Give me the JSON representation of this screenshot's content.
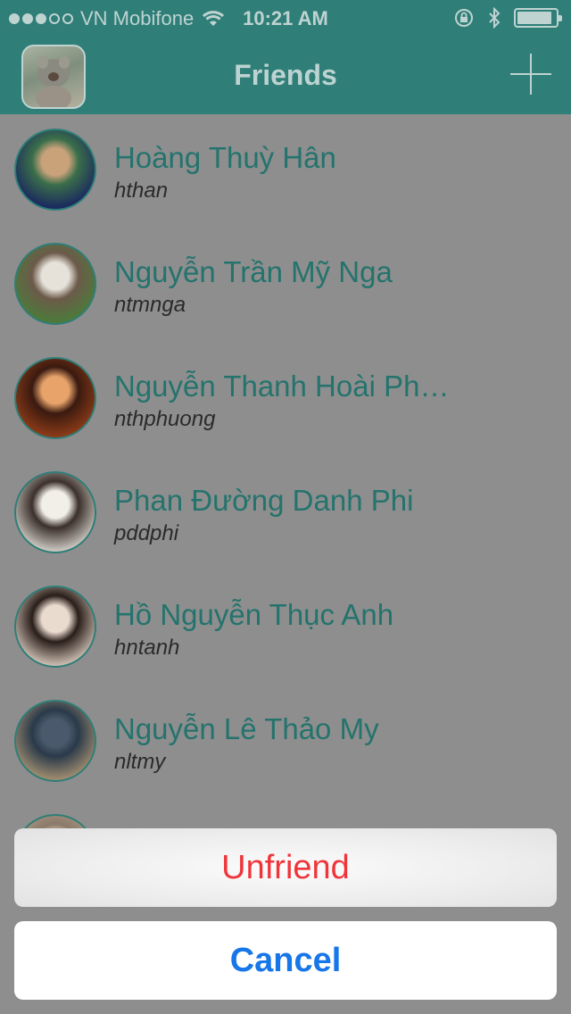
{
  "status_bar": {
    "carrier": "VN Mobifone",
    "time": "10:21 AM"
  },
  "nav": {
    "title": "Friends"
  },
  "friends": [
    {
      "name": "Hoàng Thuỳ Hân",
      "username": "hthan",
      "avatar_colors": [
        "#1b2a5e",
        "#c9a27a",
        "#3a6e4a"
      ]
    },
    {
      "name": "Nguyễn Trần Mỹ Nga",
      "username": "ntmnga",
      "avatar_colors": [
        "#4d7a3a",
        "#e6e2da",
        "#6c5a4a"
      ]
    },
    {
      "name": "Nguyễn Thanh Hoài Ph…",
      "username": "nthphuong",
      "avatar_colors": [
        "#8a3a18",
        "#e7a36a",
        "#3a1a10"
      ]
    },
    {
      "name": "Phan Đường Danh Phi",
      "username": "pddphi",
      "avatar_colors": [
        "#c8c4bd",
        "#f2efe9",
        "#3b2f2a"
      ]
    },
    {
      "name": "Hồ Nguyễn Thục Anh",
      "username": "hntanh",
      "avatar_colors": [
        "#c7b9ad",
        "#eadbcf",
        "#2a1e1a"
      ]
    },
    {
      "name": "Nguyễn Lê Thảo My",
      "username": "nltmy",
      "avatar_colors": [
        "#9c8a6e",
        "#4a5a6c",
        "#2a3a4a"
      ]
    },
    {
      "name": "",
      "username": "",
      "avatar_colors": [
        "#b8a08a",
        "#d8c4b0",
        "#8a7a6a"
      ]
    }
  ],
  "action_sheet": {
    "unfriend_label": "Unfriend",
    "cancel_label": "Cancel"
  }
}
